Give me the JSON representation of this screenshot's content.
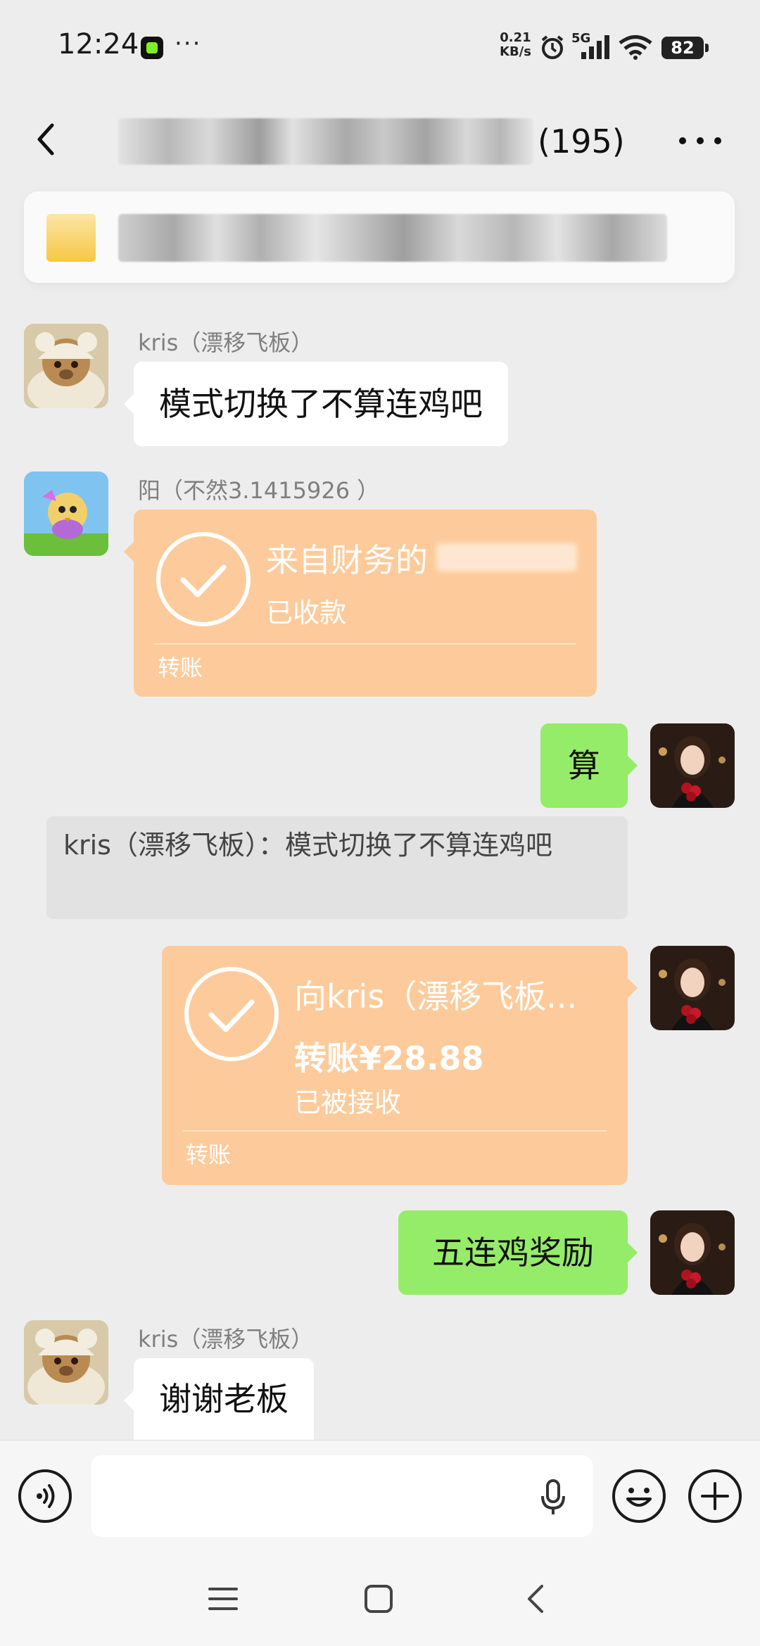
{
  "status_bar": {
    "time": "12:24",
    "more_dots": "···",
    "net_speed_top": "0.21",
    "net_speed_bottom": "KB/s",
    "network_type": "5G",
    "battery": "82"
  },
  "header": {
    "back_icon": "chevron-left-icon",
    "title_count": "(195)",
    "more_icon": "ellipsis-icon"
  },
  "messages": [
    {
      "sender": "kris（漂移飞板）",
      "text": "模式切换了不算连鸡吧"
    },
    {
      "sender": "阳（不然3.1415926 ）",
      "transfer_title": "来自财务的",
      "transfer_status": "已收款",
      "transfer_label": "转账"
    },
    {
      "text": "算"
    },
    {
      "quote": "kris（漂移飞板）：模式切换了不算连鸡吧"
    },
    {
      "transfer_title": "向kris（漂移飞板...",
      "transfer_amount": "转账¥28.88",
      "transfer_status": "已被接收",
      "transfer_label": "转账"
    },
    {
      "text": "五连鸡奖励"
    },
    {
      "sender": "kris（漂移飞板）",
      "text": "谢谢老板"
    }
  ],
  "input_bar": {
    "voice_icon": "voice-icon",
    "mic_icon": "mic-icon",
    "emoji_icon": "emoji-icon",
    "plus_icon": "plus-icon"
  },
  "colors": {
    "background": "#ededed",
    "bubble_green": "#95ec69",
    "transfer_orange": "#fdcb9b"
  }
}
